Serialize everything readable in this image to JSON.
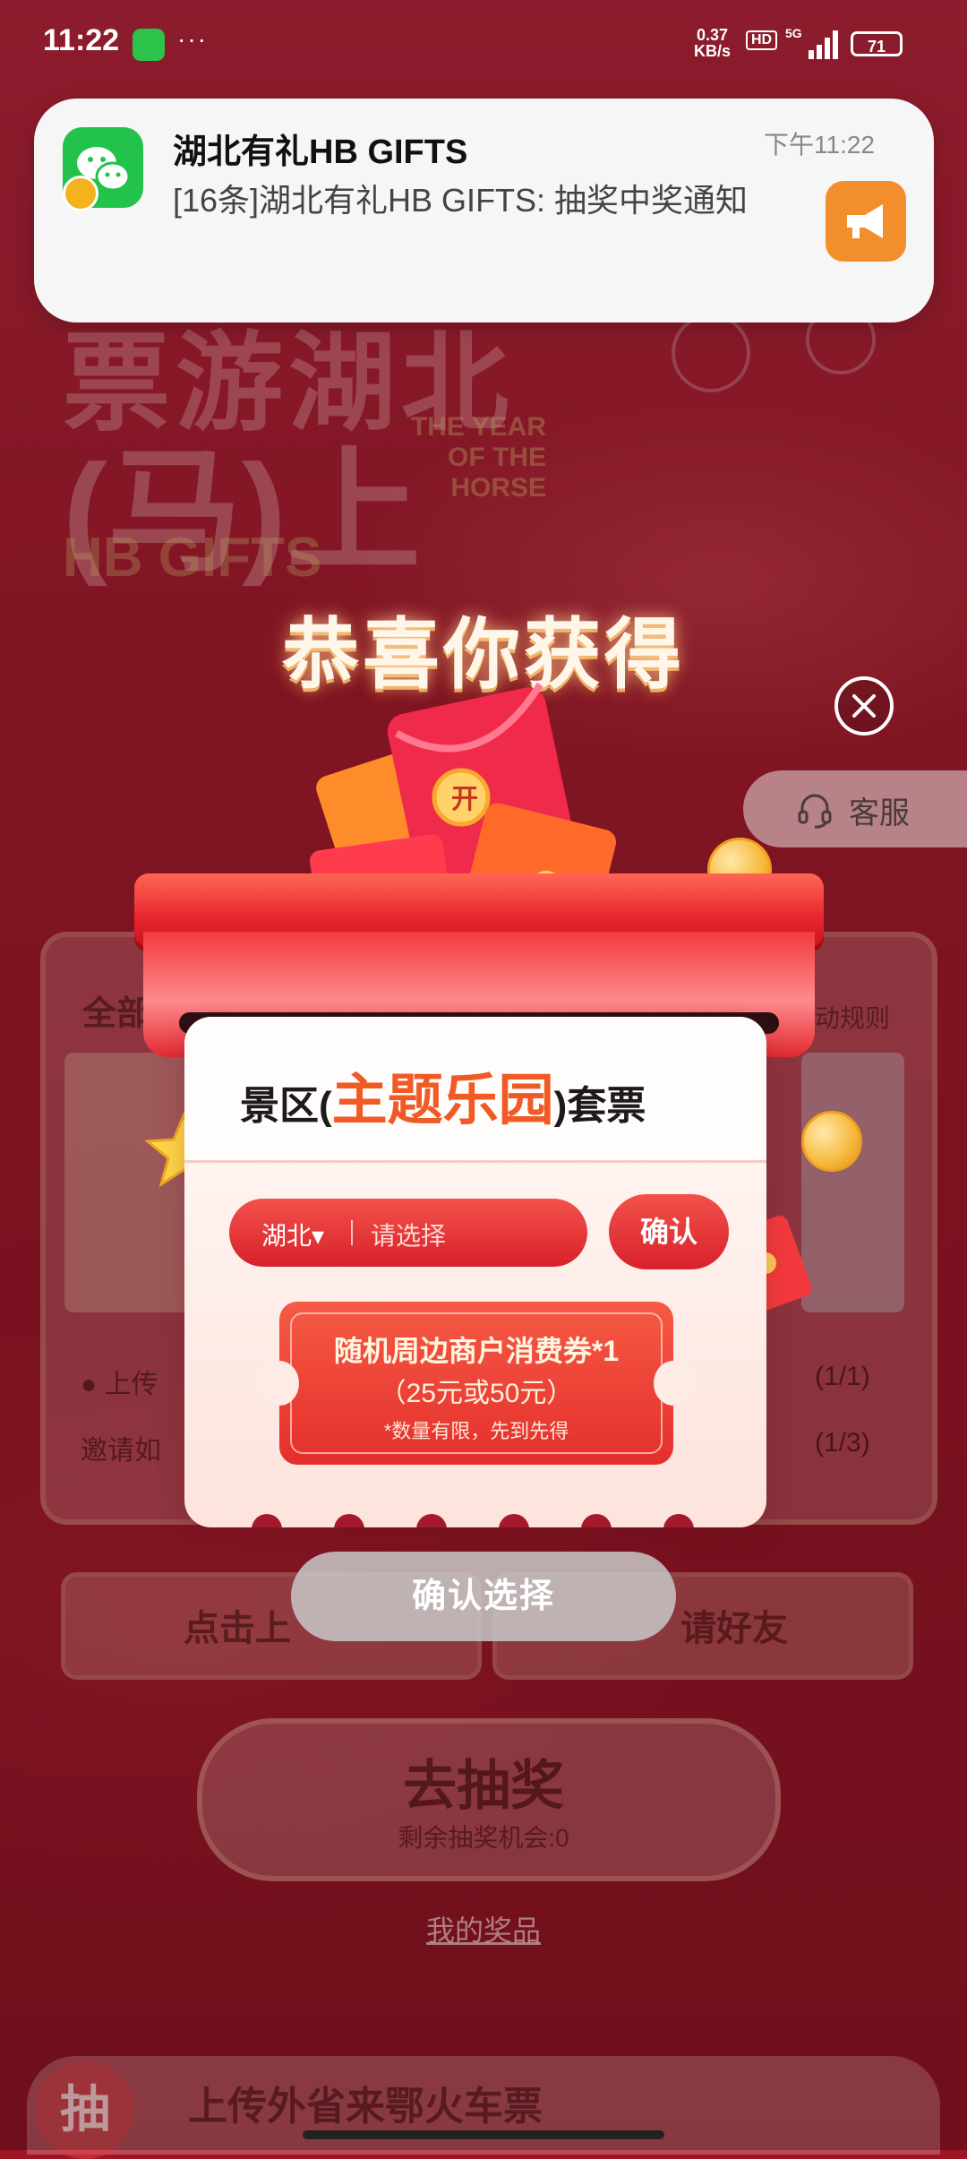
{
  "status_bar": {
    "time": "11:22",
    "dots": "···",
    "net_speed": "0.37",
    "net_unit": "KB/s",
    "hd": "HD",
    "signal": "5G",
    "battery": "71"
  },
  "notification": {
    "app_title": "湖北有礼HB GIFTS",
    "body": "[16条]湖北有礼HB GIFTS: 抽奖中奖通知",
    "time": "下午11:22",
    "icon": "wechat-icon",
    "action_icon": "megaphone-icon"
  },
  "background": {
    "title_line1": "票游湖北",
    "title_line2": "(马)上",
    "hb_gifts": "HB GIFTS",
    "year_of_horse": "THE YEAR OF THE HORSE",
    "rules": "动规则",
    "row_count_1": "(1/1)",
    "row_count_2": "(1/3)",
    "invite_prefix": "邀请如",
    "btn_left": "点击上",
    "btn_right": "请好友",
    "draw_title": "去抽奖",
    "draw_sub": "剩余抽奖机会:0",
    "my_prizes": "我的奖品",
    "bottom_banner": "上传外省来鄂火车票",
    "bottom_circle": "抽"
  },
  "popup": {
    "congrats": "恭喜你获得",
    "package_prefix": "景区(",
    "package_accent": "主题乐园",
    "package_suffix": ")套票",
    "region": "湖北▾",
    "select_placeholder": "请选择",
    "confirm": "确认",
    "coupon_line1": "随机周边商户消费券*1",
    "coupon_line2": "（25元或50元）",
    "coupon_line3": "*数量有限，先到先得",
    "confirm_selection": "确认选择",
    "open_label": "开"
  },
  "service": {
    "label": "客服"
  },
  "colors": {
    "accent": "#f05a25",
    "brand_red": "#d8212b",
    "wechat_green": "#22c24b"
  }
}
